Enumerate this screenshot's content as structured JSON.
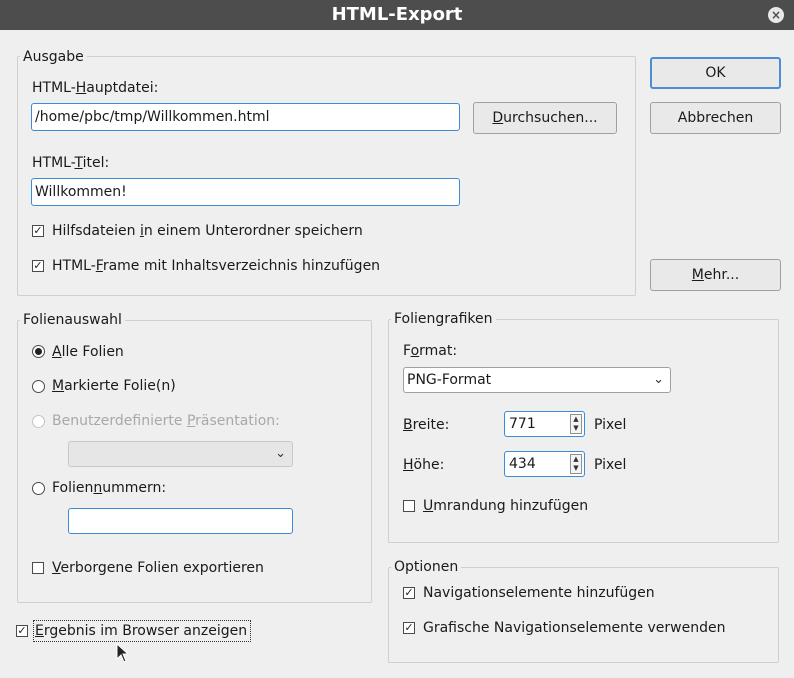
{
  "window": {
    "title": "HTML-Export",
    "close_glyph": "×"
  },
  "ausgabe": {
    "legend": "Ausgabe",
    "hauptdatei_label_pre": "HTML-",
    "hauptdatei_label_ul": "H",
    "hauptdatei_label_post": "auptdatei:",
    "hauptdatei_value": "/home/pbc/tmp/Willkommen.html",
    "browse_pre": "",
    "browse_ul": "D",
    "browse_post": "urchsuchen...",
    "titel_label_pre": "HTML-",
    "titel_label_ul": "T",
    "titel_label_post": "itel:",
    "titel_value": "Willkommen!",
    "hilfsdateien_pre": "Hilfsdateien ",
    "hilfsdateien_ul": "i",
    "hilfsdateien_post": "n einem Unterordner speichern",
    "hilfsdateien_checked": true,
    "frame_pre": "HTML-",
    "frame_ul": "F",
    "frame_post": "rame mit Inhaltsverzeichnis hinzufügen",
    "frame_checked": true
  },
  "buttons": {
    "ok": "OK",
    "abbrechen": "Abbrechen",
    "mehr_ul": "M",
    "mehr_post": "ehr..."
  },
  "folienauswahl": {
    "legend": "Folienauswahl",
    "alle_ul": "A",
    "alle_post": "lle Folien",
    "markierte_ul": "M",
    "markierte_post": "arkierte Folie(n)",
    "benutzer_pre": "Benutzerdefinierte ",
    "benutzer_ul": "P",
    "benutzer_post": "räsentation:",
    "nummern_pre": "Folien",
    "nummern_ul": "n",
    "nummern_post": "ummern:",
    "nummern_value": "",
    "verborgene_ul": "V",
    "verborgene_post": "erborgene Folien exportieren",
    "selected": "alle"
  },
  "foliengrafiken": {
    "legend": "Foliengrafiken",
    "format_pre": "F",
    "format_ul": "o",
    "format_post": "rmat:",
    "format_value": "PNG-Format",
    "breite_ul": "B",
    "breite_post": "reite:",
    "breite_value": "771",
    "hoehe_ul": "H",
    "hoehe_post": "öhe:",
    "hoehe_value": "434",
    "unit": "Pixel",
    "umrandung_ul": "U",
    "umrandung_post": "mrandung hinzufügen"
  },
  "optionen": {
    "legend": "Optionen",
    "navigation": "Navigationselemente hinzufügen",
    "grafische": "Grafische Navigationselemente verwenden"
  },
  "ergebnis": {
    "pre": "",
    "ul": "E",
    "post": "rgebnis im Browser anzeigen",
    "checked": true
  },
  "colors": {
    "titlebar": "#4d4d4d",
    "focus": "#3c8ad8",
    "dialog_bg": "#efefef"
  },
  "check_glyph": "✓"
}
